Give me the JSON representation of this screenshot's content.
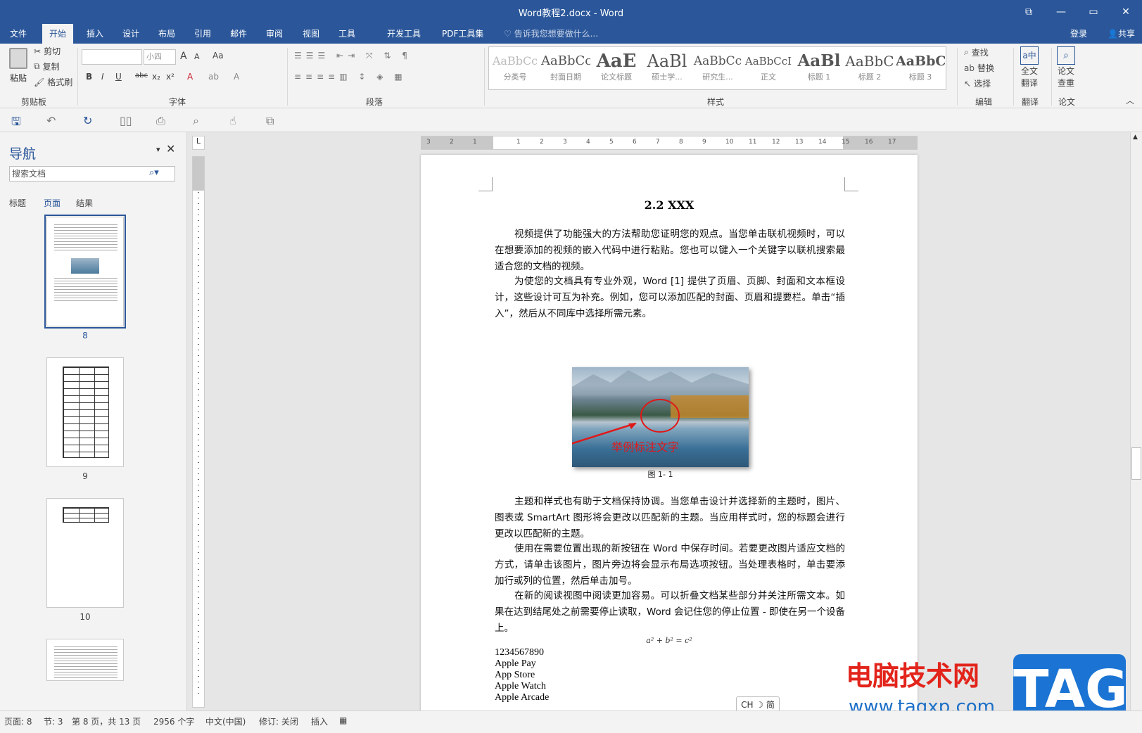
{
  "window": {
    "title": "Word教程2.docx - Word",
    "min": "—",
    "restore": "▭",
    "close": "✕",
    "ribbon_opt": "⧉"
  },
  "tabs": [
    "文件",
    "开始",
    "插入",
    "设计",
    "布局",
    "引用",
    "邮件",
    "审阅",
    "视图",
    "工具",
    "开发工具",
    "PDF工具集"
  ],
  "active_tab": "开始",
  "tellme": "告诉我您想要做什么...",
  "login": "登录",
  "share": "共享",
  "ribbon": {
    "clipboard": {
      "paste": "粘贴",
      "cut": "剪切",
      "copy": "复制",
      "format_painter": "格式刷",
      "label": "剪贴板"
    },
    "font": {
      "font_name": "",
      "font_size": "小四",
      "label": "字体",
      "bold": "B",
      "italic": "I",
      "underline": "U",
      "strike": "abc",
      "sub": "x₂",
      "sup": "x²",
      "grow": "A",
      "shrink": "A",
      "case": "Aa"
    },
    "paragraph": {
      "label": "段落"
    },
    "styles": {
      "label": "样式",
      "items": [
        {
          "sample": "AaBbCc",
          "name": "分类号"
        },
        {
          "sample": "AaBbCc",
          "name": "封面日期"
        },
        {
          "sample": "AaE",
          "name": "论文标题"
        },
        {
          "sample": "AaBl",
          "name": "硕士学..."
        },
        {
          "sample": "AaBbCc",
          "name": "研究生..."
        },
        {
          "sample": "AaBbCcI",
          "name": "正文"
        },
        {
          "sample": "AaBl",
          "name": "标题 1"
        },
        {
          "sample": "AaBbC",
          "name": "标题 2"
        },
        {
          "sample": "AaBbC",
          "name": "标题 3"
        }
      ]
    },
    "editing": {
      "find": "查找",
      "replace": "替换",
      "select": "选择",
      "label": "编辑"
    },
    "translate": {
      "btn_line1": "全文",
      "btn_line2": "翻译",
      "label": "翻译"
    },
    "paper": {
      "btn_line1": "论文",
      "btn_line2": "查重",
      "label": "论文"
    }
  },
  "nav": {
    "title": "导航",
    "search_placeholder": "搜索文档",
    "tabs": [
      "标题",
      "页面",
      "结果"
    ],
    "active_tab": "页面",
    "pages": [
      "8",
      "9",
      "10"
    ]
  },
  "ruler": {
    "labels": [
      "3",
      "2",
      "1",
      "1",
      "2",
      "3",
      "4",
      "5",
      "6",
      "7",
      "8",
      "9",
      "10",
      "11",
      "12",
      "13",
      "14",
      "15",
      "16",
      "17"
    ]
  },
  "document": {
    "heading": "2.2 XXX",
    "paragraphs": [
      "视频提供了功能强大的方法帮助您证明您的观点。当您单击联机视频时，可以在想要添加的视频的嵌入代码中进行粘贴。您也可以键入一个关键字以联机搜索最适合您的文档的视频。",
      "为使您的文档具有专业外观，Word [1] 提供了页眉、页脚、封面和文本框设计，这些设计可互为补充。例如，您可以添加匹配的封面、页眉和提要栏。单击“插入”，然后从不同库中选择所需元素。",
      "主题和样式也有助于文档保持协调。当您单击设计并选择新的主题时，图片、图表或 SmartArt 图形将会更改以匹配新的主题。当应用样式时，您的标题会进行更改以匹配新的主题。",
      "使用在需要位置出现的新按钮在 Word 中保存时间。若要更改图片适应文档的方式，请单击该图片，图片旁边将会显示布局选项按钮。当处理表格时，单击要添加行或列的位置，然后单击加号。",
      "在新的阅读视图中阅读更加容易。可以折叠文档某些部分并关注所需文本。如果在达到结尾处之前需要停止读取，Word 会记住您的停止位置 - 即使在另一个设备上。"
    ],
    "figure_annotation": "举例标注文字",
    "figure_caption": "图 1- 1",
    "equation": "a² + b² = c²",
    "lines": [
      "1234567890",
      "Apple Pay",
      "App Store",
      "Apple Watch",
      "Apple Arcade"
    ]
  },
  "status": {
    "page": "页面: 8",
    "section": "节: 3",
    "pages": "第 8 页，共 13 页",
    "words": "2956 个字",
    "language": "中文(中国)",
    "track": "修订: 关闭",
    "mode": "插入"
  },
  "ime": "CH ☽ 简",
  "watermark": {
    "cn": "电脑技术网",
    "url": "www.tagxp.com",
    "tag": "TAG"
  }
}
